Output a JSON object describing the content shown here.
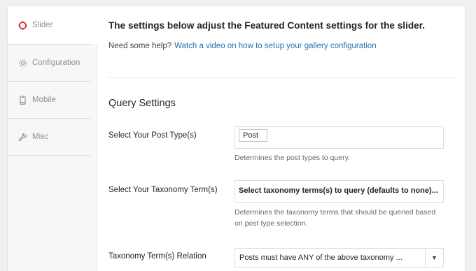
{
  "sidebar": {
    "items": [
      {
        "label": "Slider",
        "icon": "slider-icon",
        "active": true
      },
      {
        "label": "Configuration",
        "icon": "gear-icon"
      },
      {
        "label": "Mobile",
        "icon": "mobile-icon"
      },
      {
        "label": "Misc",
        "icon": "wrench-icon"
      }
    ]
  },
  "main": {
    "heading": "The settings below adjust the Featured Content settings for the slider.",
    "help_prefix": "Need some help?",
    "help_link": "Watch a video on how to setup your gallery configuration",
    "section_title": "Query Settings",
    "fields": [
      {
        "label": "Select Your Post Type(s)",
        "tokens": [
          "Post"
        ],
        "description": "Determines the post types to query."
      },
      {
        "label": "Select Your Taxonomy Term(s)",
        "placeholder": "Select taxonomy terms(s) to query (defaults to none)...",
        "description_line1": "Determines the taxonomy terms that should be queried based",
        "description_line2": "on post type selection."
      },
      {
        "label": "Taxonomy Term(s) Relation",
        "selected": "Posts must have ANY of the above taxonomy ..."
      }
    ]
  },
  "colors": {
    "accent_link": "#2271b1",
    "active_icon": "#d63638"
  }
}
